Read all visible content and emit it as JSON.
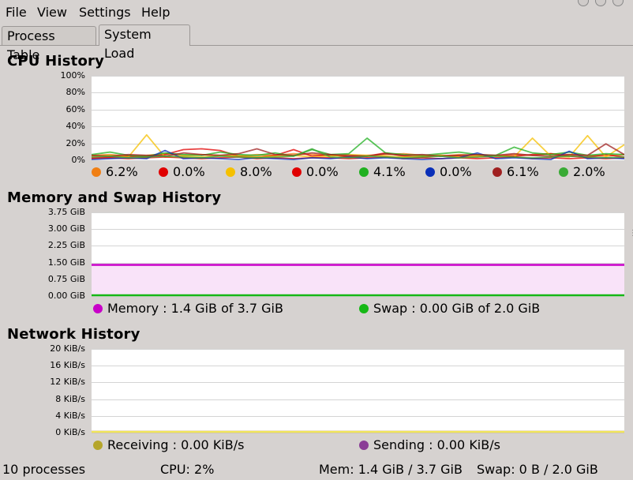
{
  "menu": {
    "file": "File",
    "view": "View",
    "settings": "Settings",
    "help": "Help"
  },
  "tabs": {
    "process_table": "Process Table",
    "system_load": "System Load"
  },
  "cpu": {
    "title": "CPU History",
    "yticks": [
      "100%",
      "80%",
      "60%",
      "40%",
      "20%",
      "0%"
    ],
    "legend": [
      {
        "color": "#f07f13",
        "label": "6.2%"
      },
      {
        "color": "#e00000",
        "label": "0.0%"
      },
      {
        "color": "#f5c000",
        "label": "8.0%"
      },
      {
        "color": "#e00000",
        "label": "0.0%"
      },
      {
        "color": "#20b020",
        "label": "4.1%"
      },
      {
        "color": "#0a2fb8",
        "label": "0.0%"
      },
      {
        "color": "#a02020",
        "label": "6.1%"
      },
      {
        "color": "#3aaa35",
        "label": "2.0%"
      }
    ]
  },
  "memory": {
    "title": "Memory and Swap History",
    "yticks": [
      "3.75 GiB",
      "3.00 GiB",
      "2.25 GiB",
      "1.50 GiB",
      "0.75 GiB",
      "0.00 GiB"
    ],
    "memory_label": "Memory : 1.4 GiB of 3.7 GiB",
    "memory_color": "#c800c8",
    "swap_label": "Swap : 0.00 GiB of 2.0 GiB",
    "swap_color": "#16b816"
  },
  "network": {
    "title": "Network History",
    "yticks": [
      "20 KiB/s",
      "16 KiB/s",
      "12 KiB/s",
      "8 KiB/s",
      "4 KiB/s",
      "0 KiB/s"
    ],
    "receiving_label": "Receiving : 0.00 KiB/s",
    "receiving_color": "#b5a52a",
    "sending_label": "Sending : 0.00 KiB/s",
    "sending_color": "#8a3c96"
  },
  "status": {
    "processes": "10 processes",
    "cpu": "CPU: 2%",
    "mem": "Mem: 1.4 GiB / 3.7 GiB",
    "swap": "Swap: 0 B / 2.0 GiB"
  },
  "chart_data": [
    {
      "type": "line",
      "title": "CPU History",
      "ylim": [
        0,
        100
      ],
      "y_unit": "%",
      "grid": true,
      "series": [
        {
          "color": "#f07f13",
          "values": [
            5,
            6,
            4,
            5,
            7,
            5,
            6,
            5,
            4,
            6,
            5,
            7,
            6,
            5,
            4,
            5,
            6,
            7,
            5,
            4,
            6,
            5,
            4,
            6,
            5,
            7,
            6,
            5,
            4,
            6
          ]
        },
        {
          "color": "#e00000",
          "values": [
            2,
            3,
            4,
            3,
            6,
            12,
            13,
            11,
            4,
            3,
            5,
            12,
            4,
            6,
            3,
            4,
            8,
            4,
            3,
            5,
            4,
            3,
            5,
            4,
            6,
            7,
            4,
            3,
            6,
            3
          ]
        },
        {
          "color": "#f5c000",
          "values": [
            4,
            5,
            3,
            30,
            3,
            4,
            3,
            5,
            4,
            3,
            4,
            5,
            3,
            4,
            6,
            5,
            4,
            3,
            4,
            5,
            3,
            4,
            5,
            3,
            26,
            4,
            3,
            29,
            3,
            18
          ]
        },
        {
          "color": "#e00000",
          "values": [
            1,
            2,
            1,
            2,
            3,
            2,
            1,
            2,
            3,
            1,
            2,
            1,
            2,
            2,
            1,
            2,
            3,
            1,
            2,
            1,
            2,
            1,
            2,
            3,
            1,
            2,
            1,
            2,
            1,
            2
          ]
        },
        {
          "color": "#20b020",
          "values": [
            6,
            9,
            5,
            4,
            8,
            6,
            5,
            9,
            6,
            5,
            8,
            4,
            12,
            6,
            7,
            26,
            8,
            6,
            5,
            7,
            9,
            6,
            5,
            15,
            8,
            6,
            9,
            5,
            7,
            6
          ]
        },
        {
          "color": "#0a2fb8",
          "values": [
            0,
            1,
            2,
            1,
            11,
            1,
            2,
            1,
            0,
            2,
            1,
            0,
            2,
            1,
            3,
            1,
            2,
            1,
            0,
            1,
            2,
            8,
            1,
            2,
            1,
            0,
            10,
            1,
            2,
            1
          ]
        },
        {
          "color": "#a02020",
          "values": [
            5,
            4,
            6,
            5,
            4,
            8,
            6,
            5,
            7,
            13,
            6,
            5,
            8,
            6,
            5,
            4,
            7,
            5,
            6,
            4,
            5,
            6,
            5,
            7,
            5,
            4,
            6,
            5,
            19,
            6
          ]
        },
        {
          "color": "#3aaa35",
          "values": [
            3,
            4,
            2,
            3,
            4,
            3,
            2,
            4,
            3,
            2,
            3,
            4,
            13,
            3,
            2,
            4,
            3,
            2,
            3,
            4,
            2,
            3,
            4,
            3,
            2,
            3,
            4,
            3,
            2,
            3
          ]
        }
      ]
    },
    {
      "type": "area",
      "title": "Memory and Swap History",
      "ylim": [
        0,
        3.75
      ],
      "y_unit": "GiB",
      "grid": true,
      "series": [
        {
          "name": "Memory",
          "color": "#c800c8",
          "values": [
            1.4,
            1.4,
            1.4,
            1.4,
            1.4,
            1.4,
            1.4,
            1.4,
            1.4,
            1.4,
            1.4,
            1.4
          ]
        },
        {
          "name": "Swap",
          "color": "#16b816",
          "values": [
            0,
            0,
            0,
            0,
            0,
            0,
            0,
            0,
            0,
            0,
            0,
            0
          ]
        }
      ]
    },
    {
      "type": "line",
      "title": "Network History",
      "ylim": [
        0,
        20
      ],
      "y_unit": "KiB/s",
      "grid": true,
      "series": [
        {
          "name": "Receiving",
          "color": "#b5a52a",
          "values": [
            0,
            0,
            0,
            0,
            0,
            0,
            0,
            0,
            0,
            0,
            0,
            0
          ]
        },
        {
          "name": "Sending",
          "color": "#8a3c96",
          "values": [
            0,
            0,
            0,
            0,
            0,
            0,
            0,
            0,
            0,
            0,
            0,
            0
          ]
        }
      ]
    }
  ]
}
